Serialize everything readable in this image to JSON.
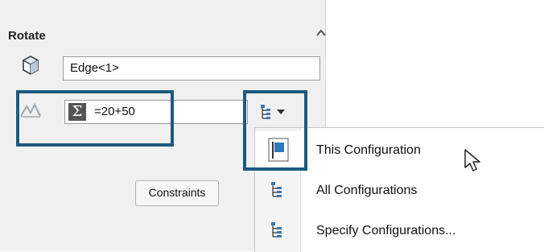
{
  "panel": {
    "title": "Rotate",
    "edge_value": "Edge<1>",
    "angle_value": "=20+50",
    "constraints_label": "Constraints"
  },
  "menu": {
    "items": [
      {
        "label": "This Configuration",
        "icon": "this-configuration-icon"
      },
      {
        "label": "All Configurations",
        "icon": "all-configurations-icon"
      },
      {
        "label": "Specify Configurations...",
        "icon": "specify-configurations-icon"
      }
    ]
  },
  "colors": {
    "highlight": "#1c5a7f",
    "panel_bg": "#f0f0f0",
    "equation_icon_bg": "#555555"
  }
}
